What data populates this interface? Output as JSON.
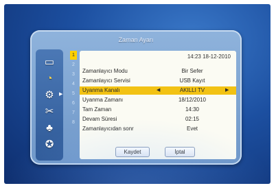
{
  "window": {
    "title": "Zaman Ayarı",
    "datetime": "14:23 18-12-2010"
  },
  "sidebar": {
    "icons": [
      "tv-icon",
      "satellite-dish-icon",
      "gear-icon",
      "tools-icon",
      "parental-users-icon",
      "media-reel-icon"
    ]
  },
  "timer_list": {
    "numbers": [
      "1",
      "2",
      "3",
      "4",
      "5",
      "6",
      "7",
      "8"
    ],
    "active_number": "1"
  },
  "fields": [
    {
      "label": "Zamanlayıcı Modu",
      "value": "Bir Sefer"
    },
    {
      "label": "Zamanlayıcı Servisi",
      "value": "USB Kayıt"
    },
    {
      "label": "Uyanma Kanalı",
      "value": "AKILLI TV"
    },
    {
      "label": "Uyanma Zamanı",
      "value": "18/12/2010"
    },
    {
      "label": "Tam Zaman",
      "value": "14:30"
    },
    {
      "label": "Devam Süresi",
      "value": "02:15"
    },
    {
      "label": "Zamanlayıcıdan sonr",
      "value": "Evet"
    }
  ],
  "buttons": {
    "save": "Kaydet",
    "cancel": "İptal"
  },
  "colors": {
    "highlight": "#f2c214",
    "accent_number": "#ffd000"
  }
}
